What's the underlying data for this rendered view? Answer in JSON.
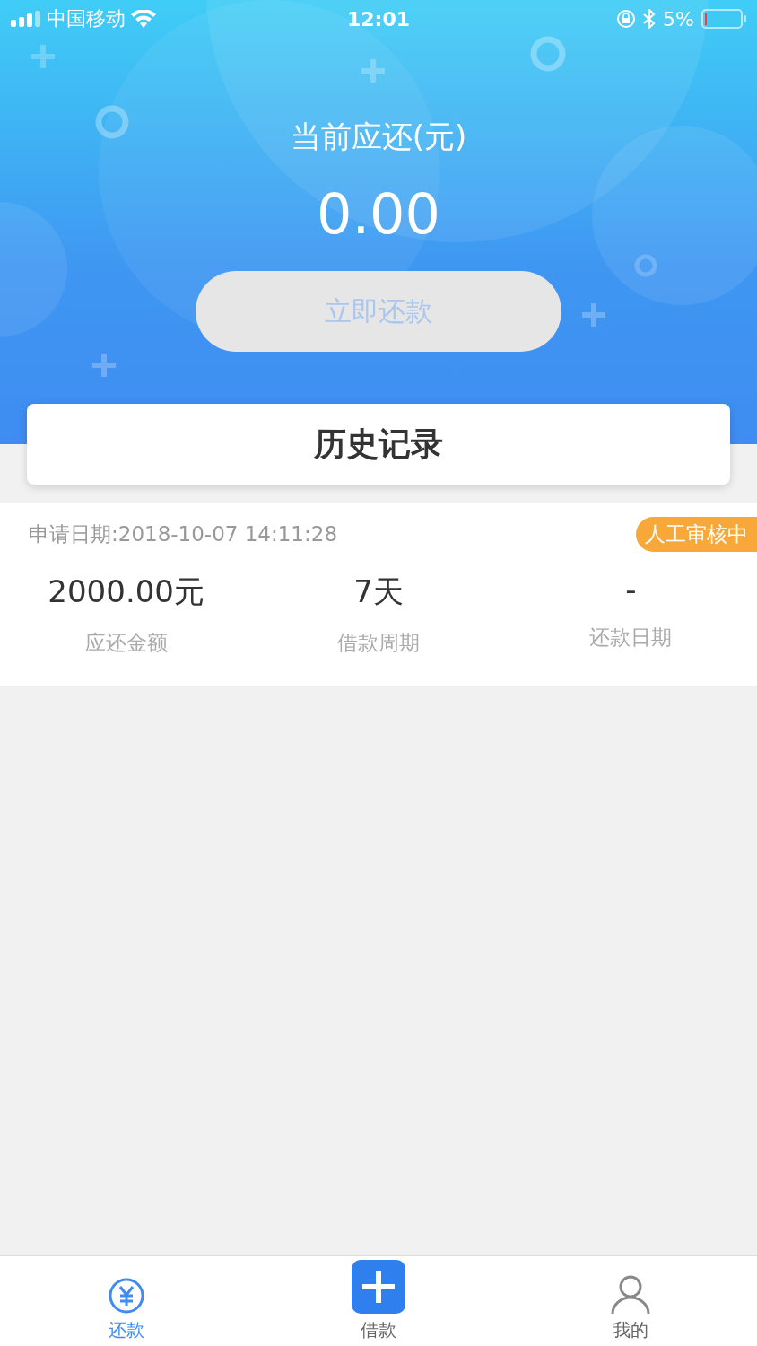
{
  "status_bar": {
    "carrier": "中国移动",
    "time": "12:01",
    "battery": "5%"
  },
  "header": {
    "title": "当前应还(元)",
    "amount": "0.00",
    "button": {
      "label": "立即还款",
      "disabled": true
    }
  },
  "history_card": {
    "title": "历史记录"
  },
  "record": {
    "date": "申请日期:2018-10-07 14:11:28",
    "status": "人工审核中",
    "fields": [
      {
        "value": "2000.00元",
        "label": "应还金额"
      },
      {
        "value": "7天",
        "label": "借款周期"
      },
      {
        "value": "-",
        "label": "还款日期"
      }
    ]
  },
  "tab_bar": [
    {
      "kind": "yuan",
      "label": "还款",
      "selected": true
    },
    {
      "kind": "plus",
      "label": "借款",
      "selected": false
    },
    {
      "kind": "person",
      "label": "我的",
      "selected": false
    }
  ]
}
